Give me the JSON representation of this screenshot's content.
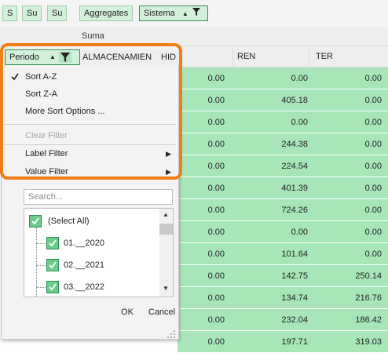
{
  "topbar": {
    "chips": [
      "S",
      "Su",
      "Su"
    ],
    "aggregates": "Aggregates",
    "sistema": "Sistema"
  },
  "suma": "Suma",
  "header": {
    "periodo": "Periodo",
    "almacen": "ALMACENAMIEN",
    "hid": "HID",
    "ren": "REN",
    "ter": "TER"
  },
  "rows": [
    [
      "0.00",
      "0.00",
      "0.00"
    ],
    [
      "0.00",
      "405.18",
      "0.00"
    ],
    [
      "0.00",
      "0.00",
      "0.00"
    ],
    [
      "0.00",
      "244.38",
      "0.00"
    ],
    [
      "0.00",
      "224.54",
      "0.00"
    ],
    [
      "0.00",
      "401.39",
      "0.00"
    ],
    [
      "0.00",
      "724.26",
      "0.00"
    ],
    [
      "0.00",
      "0.00",
      "0.00"
    ],
    [
      "0.00",
      "101.64",
      "0.00"
    ],
    [
      "0.00",
      "142.75",
      "250.14"
    ],
    [
      "0.00",
      "134.74",
      "216.76"
    ],
    [
      "0.00",
      "232.04",
      "186.42"
    ],
    [
      "0.00",
      "197.71",
      "319.03"
    ]
  ],
  "menu": {
    "sort_az": "Sort A-Z",
    "sort_za": "Sort Z-A",
    "more_sort": "More Sort Options ...",
    "clear_filter": "Clear Filter",
    "label_filter": "Label Filter",
    "value_filter": "Value Filter"
  },
  "search_placeholder": "Search...",
  "list": {
    "select_all": "(Select All)",
    "items": [
      "01.__2020",
      "02.__2021",
      "03.__2022"
    ]
  },
  "buttons": {
    "ok": "OK",
    "cancel": "Cancel"
  },
  "colors": {
    "accent_green": "#a8e6ba",
    "highlight_orange": "#f07f1a"
  }
}
